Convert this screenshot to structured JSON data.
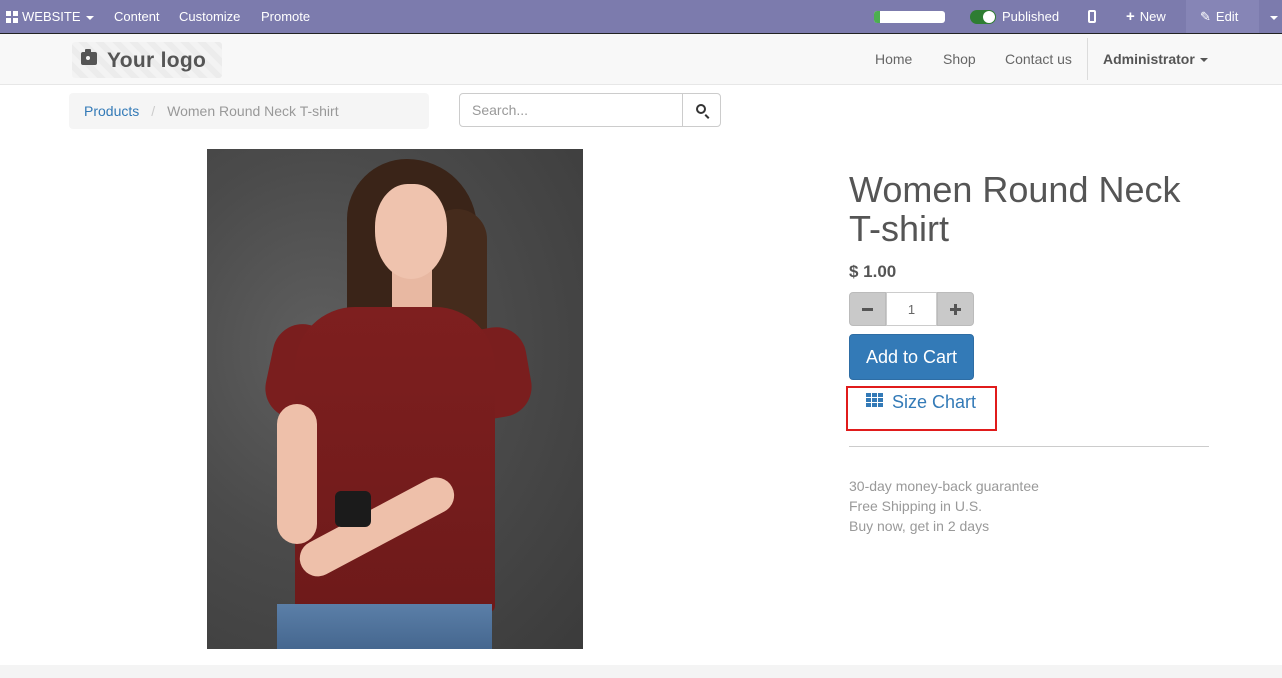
{
  "adminbar": {
    "website_label": "WEBSITE",
    "content_label": "Content",
    "customize_label": "Customize",
    "promote_label": "Promote",
    "progress_fraction": 0.08,
    "published_label": "Published",
    "new_label": "New",
    "edit_label": "Edit",
    "bar_color": "#7c7bad"
  },
  "header": {
    "logo_text": "Your logo",
    "nav": {
      "home": "Home",
      "shop": "Shop",
      "contact": "Contact us",
      "user": "Administrator"
    }
  },
  "breadcrumb": {
    "products": "Products",
    "separator": "/",
    "current": "Women Round Neck T-shirt"
  },
  "search": {
    "placeholder": "Search..."
  },
  "product": {
    "title": "Women Round Neck T-shirt",
    "price": "$ 1.00",
    "quantity": "1",
    "add_to_cart": "Add to Cart",
    "size_chart": "Size Chart",
    "guarantee_lines": [
      "30-day money-back guarantee",
      "Free Shipping in U.S.",
      "Buy now, get in 2 days"
    ],
    "accent_color": "#337ab7",
    "highlight_color": "#e01b1b"
  }
}
